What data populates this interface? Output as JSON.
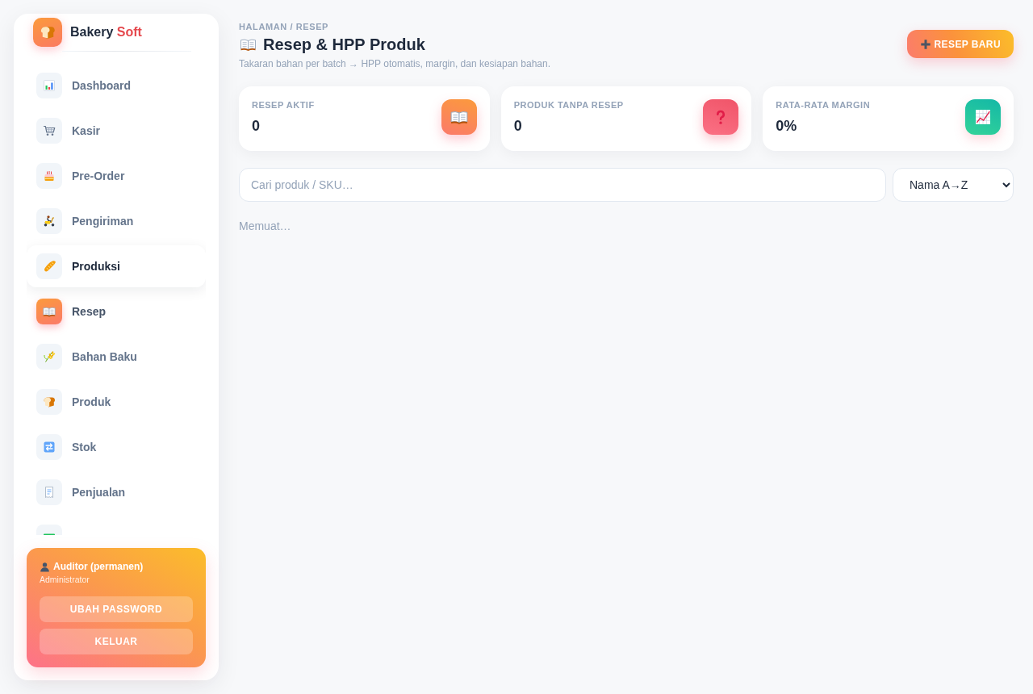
{
  "sidebar": {
    "brand": {
      "name": "Bakery",
      "accent": "Soft"
    },
    "nav": [
      {
        "label": "Dashboard",
        "selected": false,
        "hovered": false
      },
      {
        "label": "Kasir",
        "selected": false,
        "hovered": false
      },
      {
        "label": "Pre-Order",
        "selected": false,
        "hovered": false
      },
      {
        "label": "Pengiriman",
        "selected": false,
        "hovered": false
      },
      {
        "label": "Produksi",
        "selected": false,
        "hovered": true
      },
      {
        "label": "Resep",
        "selected": true,
        "hovered": false
      },
      {
        "label": "Bahan Baku",
        "selected": false,
        "hovered": false
      },
      {
        "label": "Produk",
        "selected": false,
        "hovered": false
      },
      {
        "label": "Stok",
        "selected": false,
        "hovered": false
      },
      {
        "label": "Penjualan",
        "selected": false,
        "hovered": false
      },
      {
        "selected": false,
        "hovered": false
      }
    ],
    "user": {
      "name": "Auditor (permanen)",
      "role": "Administrator",
      "buttons": [
        "UBAH PASSWORD",
        "KELUAR"
      ]
    }
  },
  "header": {
    "breadcrumb": "HALAMAN / RESEP",
    "title": "Resep & HPP Produk",
    "subtitle": "Takaran bahan per batch → HPP otomatis, margin, dan kesiapan bahan.",
    "action": "RESEP BARU"
  },
  "stats": [
    {
      "label": "RESEP AKTIF",
      "value": "0"
    },
    {
      "label": "PRODUK TANPA RESEP",
      "value": "0"
    },
    {
      "label": "RATA-RATA MARGIN",
      "value": "0%"
    }
  ],
  "toolbar": {
    "search": {
      "placeholder": "Cari produk / SKU…"
    },
    "sort": {
      "value": "Nama A→Z"
    }
  },
  "status": "Memuat…"
}
